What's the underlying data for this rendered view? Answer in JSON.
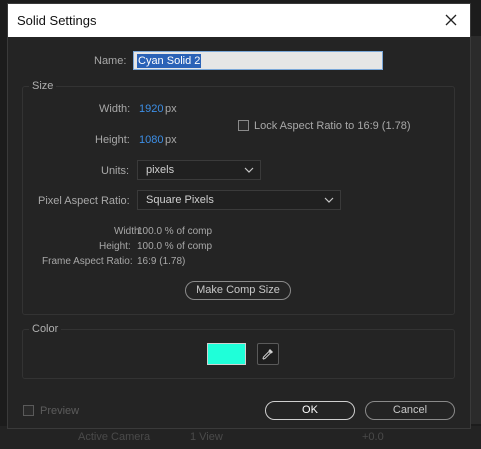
{
  "dialog": {
    "title": "Solid Settings"
  },
  "name": {
    "label": "Name:",
    "value": "Cyan Solid 2"
  },
  "size": {
    "group_title": "Size",
    "width_label": "Width:",
    "width_value": "1920",
    "height_label": "Height:",
    "height_value": "1080",
    "unit_px": "px",
    "lock_aspect_label": "Lock Aspect Ratio to 16:9 (1.78)",
    "lock_aspect_checked": false,
    "units_label": "Units:",
    "units_value": "pixels",
    "par_label": "Pixel Aspect Ratio:",
    "par_value": "Square Pixels",
    "info_width_label": "Width:",
    "info_width_value": "100.0 % of comp",
    "info_height_label": "Height:",
    "info_height_value": "100.0 % of comp",
    "info_frame_label": "Frame Aspect Ratio:",
    "info_frame_value": "16:9 (1.78)",
    "make_comp_size_label": "Make Comp Size"
  },
  "color": {
    "group_title": "Color",
    "swatch_color": "#1fffd9"
  },
  "footer": {
    "preview_label": "Preview",
    "preview_checked": false,
    "ok_label": "OK",
    "cancel_label": "Cancel"
  },
  "host": {
    "camera_label": "Active Camera",
    "view_label": "1 View",
    "offset_label": "+0.0"
  },
  "icons": {
    "close": "close-icon",
    "dropdown": "chevron-down-icon",
    "eyedropper": "eyedropper-icon"
  }
}
